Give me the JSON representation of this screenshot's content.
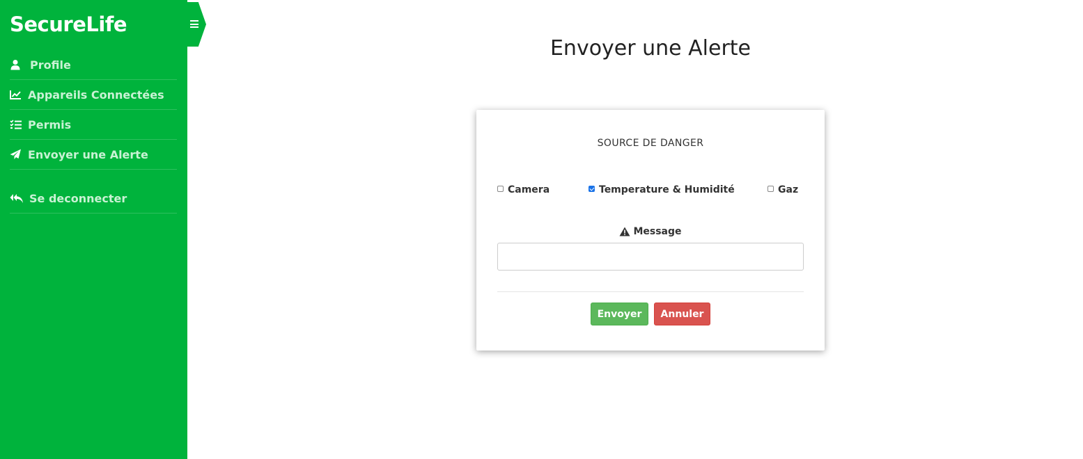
{
  "app": {
    "brand": "SecureLife"
  },
  "sidebar": {
    "items": [
      {
        "label": "Profile",
        "icon": "user-icon"
      },
      {
        "label": "Appareils Connectées",
        "icon": "chart-line-icon"
      },
      {
        "label": "Permis",
        "icon": "tasks-icon"
      },
      {
        "label": "Envoyer une Alerte",
        "icon": "paper-plane-icon"
      }
    ],
    "logout": {
      "label": "Se deconnecter",
      "icon": "reply-all-icon"
    }
  },
  "main": {
    "title": "Envoyer une Alerte"
  },
  "form": {
    "heading": "SOURCE DE DANGER",
    "options": [
      {
        "label": "Camera",
        "checked": false
      },
      {
        "label": "Temperature & Humidité",
        "checked": true
      },
      {
        "label": "Gaz",
        "checked": false
      }
    ],
    "message_label": "Message",
    "message_value": "",
    "send_label": "Envoyer",
    "cancel_label": "Annuler"
  },
  "colors": {
    "sidebar": "#00b33c",
    "send": "#5cb85c",
    "cancel": "#d9534f",
    "checkbox": "#1a73e8"
  }
}
